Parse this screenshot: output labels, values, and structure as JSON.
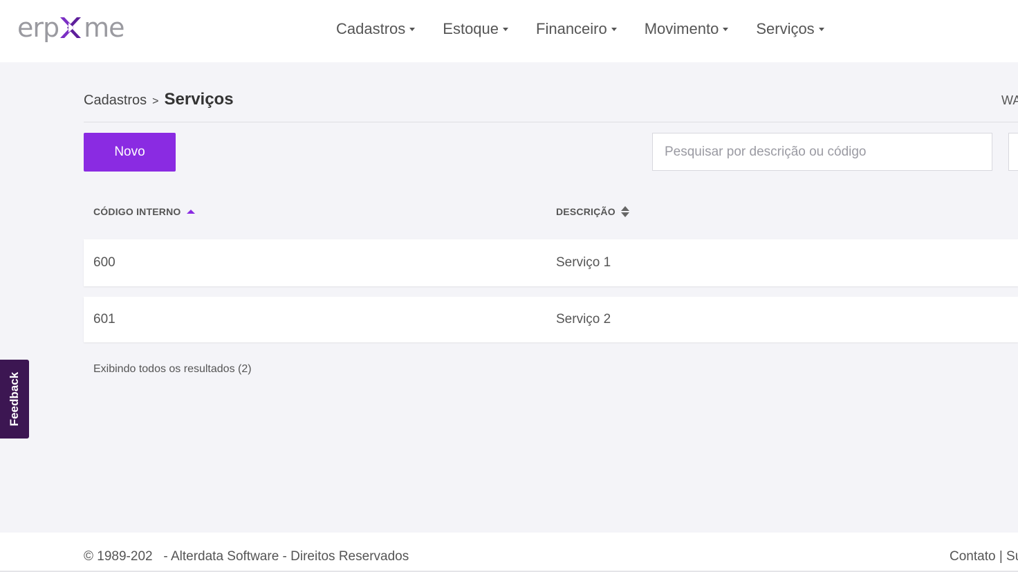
{
  "header": {
    "logo_text_left": "erp",
    "logo_text_right": "me",
    "nav": [
      {
        "label": "Cadastros",
        "icon": "caret-down-icon"
      },
      {
        "label": "Estoque",
        "icon": "caret-down-icon"
      },
      {
        "label": "Financeiro",
        "icon": "caret-down-icon"
      },
      {
        "label": "Movimento",
        "icon": "caret-down-icon"
      },
      {
        "label": "Serviços",
        "icon": "caret-down-icon"
      }
    ]
  },
  "breadcrumb": {
    "parent": "Cadastros",
    "separator": ">",
    "current": "Serviços"
  },
  "user_tag": "WA",
  "toolbar": {
    "new_label": "Novo",
    "search_placeholder": "Pesquisar por descrição ou código",
    "search_value": ""
  },
  "table": {
    "columns": [
      {
        "label": "CÓDIGO INTERNO",
        "sort": "ascending"
      },
      {
        "label": "DESCRIÇÃO",
        "sort": "none"
      }
    ],
    "rows": [
      {
        "code": "600",
        "description": "Serviço 1"
      },
      {
        "code": "601",
        "description": "Serviço 2"
      }
    ],
    "results_text": "Exibindo todos os resultados (2)"
  },
  "feedback_label": "Feedback",
  "footer": {
    "copyright": "© 1989-202   - Alterdata Software - Direitos Reservados",
    "links": [
      "Contato",
      "Su"
    ],
    "link_separator": "|"
  },
  "colors": {
    "accent": "#8a2be2",
    "feedback_bg": "#3c1652",
    "page_bg": "#f4f4f8",
    "logo_gray": "#9a9aa0"
  }
}
